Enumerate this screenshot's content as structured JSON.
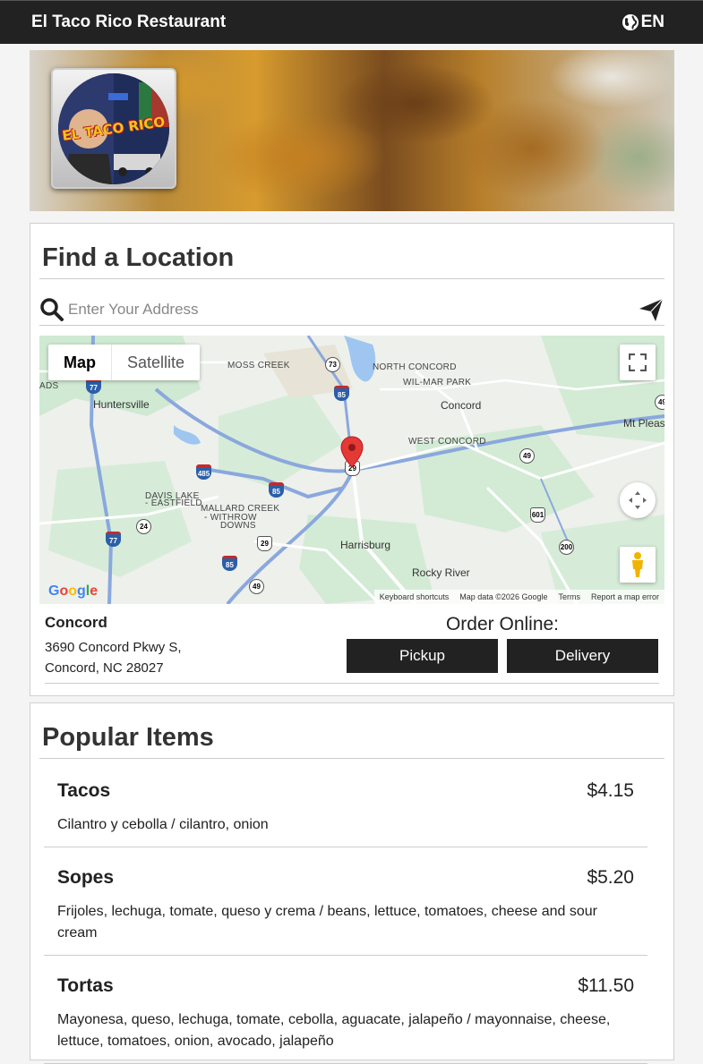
{
  "header": {
    "brand": "El Taco Rico Restaurant",
    "language": "EN",
    "icons": {
      "language": "globe-icon"
    }
  },
  "hero": {
    "logo_text": "EL TACO RICO"
  },
  "find_location": {
    "title": "Find a Location",
    "search_placeholder": "Enter Your Address",
    "icons": {
      "search": "search-icon",
      "locate": "send-arrow-icon"
    },
    "map": {
      "toggle_map": "Map",
      "toggle_satellite": "Satellite",
      "logo": "Google",
      "footer": {
        "shortcuts": "Keyboard shortcuts",
        "data": "Map data ©2026 Google",
        "terms": "Terms",
        "report": "Report a map error"
      },
      "labels": {
        "moss_creek": "MOSS CREEK",
        "north_concord": "NORTH CONCORD",
        "wilmar_park": "WIL-MAR PARK",
        "huntersville": "Huntersville",
        "concord": "Concord",
        "mt_pleasant": "Mt Pleas",
        "west_concord": "WEST CONCORD",
        "davis_lake": "DAVIS LAKE",
        "eastfield": "- EASTFIELD",
        "mallard_creek": "MALLARD CREEK",
        "withrow": "- WITHROW",
        "downs": "DOWNS",
        "harrisburg": "Harrisburg",
        "rocky_river": "Rocky River",
        "ads": "ADS"
      },
      "shields": {
        "r73": "73",
        "r77a": "77",
        "r85a": "85",
        "r49a": "49",
        "r485": "485",
        "r85b": "85",
        "r29": "29",
        "r49b": "49",
        "r601": "601",
        "r24": "24",
        "r77b": "77",
        "r29b": "29",
        "r200": "200",
        "r85c": "85",
        "r49c": "49"
      }
    },
    "location": {
      "name": "Concord",
      "address_line1": "3690 Concord Pkwy S,",
      "address_line2": "Concord, NC 28027"
    },
    "order": {
      "title": "Order Online:",
      "pickup": "Pickup",
      "delivery": "Delivery"
    }
  },
  "popular": {
    "title": "Popular Items",
    "items": [
      {
        "name": "Tacos",
        "price": "$4.15",
        "description": "Cilantro y cebolla / cilantro, onion"
      },
      {
        "name": "Sopes",
        "price": "$5.20",
        "description": "Frijoles, lechuga, tomate, queso y crema / beans, lettuce, tomatoes, cheese and sour cream"
      },
      {
        "name": "Tortas",
        "price": "$11.50",
        "description": "Mayonesa, queso, lechuga, tomate, cebolla, aguacate, jalapeño / mayonnaise, cheese, lettuce, tomatoes, onion, avocado, jalapeño"
      }
    ]
  },
  "colors": {
    "header_bg": "#222222",
    "button_bg": "#222222",
    "pin": "#e53935"
  }
}
